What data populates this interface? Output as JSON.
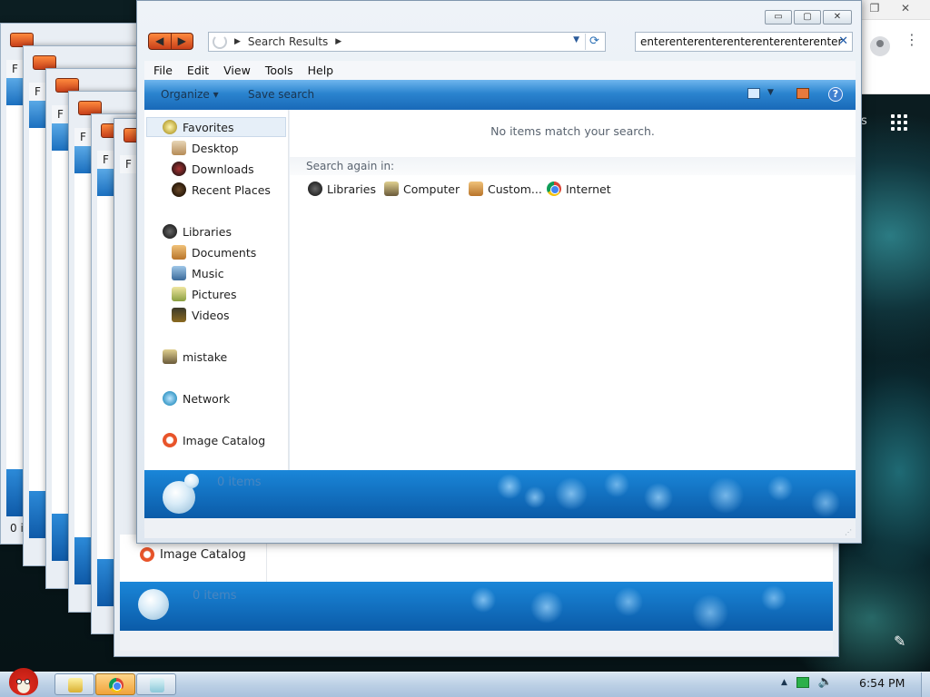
{
  "window": {
    "title_controls": {
      "minimize": "▭",
      "maximize": "▢",
      "close": "✕"
    },
    "address": {
      "crumb": "Search Results"
    },
    "search": {
      "value": "enterenterenterenterenterenterenter"
    },
    "menubar": [
      "File",
      "Edit",
      "View",
      "Tools",
      "Help"
    ],
    "command_bar": {
      "organize": "Organize",
      "save_search": "Save search",
      "help": "?"
    },
    "nav_pane": {
      "favorites": {
        "label": "Favorites",
        "items": [
          "Desktop",
          "Downloads",
          "Recent Places"
        ]
      },
      "libraries": {
        "label": "Libraries",
        "items": [
          "Documents",
          "Music",
          "Pictures",
          "Videos"
        ]
      },
      "computer": "mistake",
      "network": "Network",
      "image_catalog": "Image Catalog"
    },
    "content": {
      "empty_message": "No items match your search.",
      "search_again_label": "Search again in:",
      "search_again_items": [
        {
          "label": "Libraries",
          "icon": "library-icon"
        },
        {
          "label": "Computer",
          "icon": "computer-icon"
        },
        {
          "label": "Custom...",
          "icon": "custom-folder-icon"
        },
        {
          "label": "Internet",
          "icon": "chrome-icon"
        }
      ]
    },
    "details_pane": {
      "items_count": "0 items"
    }
  },
  "background_window": {
    "image_catalog": "Image Catalog",
    "items_count": "0 items"
  },
  "cascade_labels": {
    "menu_letter": "F",
    "status_text": "0 i"
  },
  "taskbar": {
    "clock": "6:54 PM"
  }
}
